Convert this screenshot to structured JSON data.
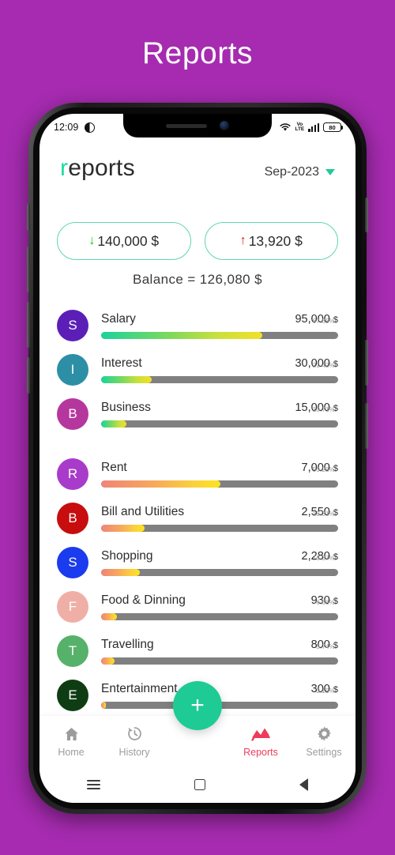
{
  "page": {
    "title": "Reports",
    "background_color": "#A62BB0"
  },
  "status_bar": {
    "time": "12:09",
    "dnd_icon": "do-not-disturb-icon",
    "wifi_icon": "wifi-icon",
    "volte_top": "Vo",
    "volte_bottom": "LTE",
    "signal_icon": "signal-bars-icon",
    "battery_level": "80"
  },
  "app_header": {
    "brand_first": "r",
    "brand_rest": "eports",
    "month": "Sep-2023",
    "dropdown_icon": "chevron-down-icon"
  },
  "summary": {
    "income": {
      "label": "140,000 $",
      "arrow": "↓",
      "direction": "down"
    },
    "expense": {
      "label": "13,920 $",
      "arrow": "↑",
      "direction": "up"
    },
    "balance_label": "Balance  =  126,080 $"
  },
  "income_categories": [
    {
      "initial": "S",
      "name": "Salary",
      "amount": "95,000",
      "currency": "$",
      "color": "#5B1FB8",
      "percent": 67.9,
      "percent_label": "67.85%"
    },
    {
      "initial": "I",
      "name": "Interest",
      "amount": "30,000",
      "currency": "$",
      "color": "#2C8FA6",
      "percent": 21.4,
      "percent_label": "21.42%"
    },
    {
      "initial": "B",
      "name": "Business",
      "amount": "15,000",
      "currency": "$",
      "color": "#B5379E",
      "percent": 10.7,
      "percent_label": "10.71%"
    }
  ],
  "expense_categories": [
    {
      "initial": "R",
      "name": "Rent",
      "amount": "7,000",
      "currency": "$",
      "color": "#A93BCB",
      "percent": 50.2,
      "percent_label": "50.28%"
    },
    {
      "initial": "B",
      "name": "Bill and Utilities",
      "amount": "2,550",
      "currency": "$",
      "color": "#C70D0D",
      "percent": 18.3,
      "percent_label": "18.31%"
    },
    {
      "initial": "S",
      "name": "Shopping",
      "amount": "2,280",
      "currency": "$",
      "color": "#1B3BEF",
      "percent": 16.3,
      "percent_label": "16.37%"
    },
    {
      "initial": "F",
      "name": "Food & Dinning",
      "amount": "930",
      "currency": "$",
      "color": "#F0AFA6",
      "percent": 6.6,
      "percent_label": "6.68%"
    },
    {
      "initial": "T",
      "name": "Travelling",
      "amount": "800",
      "currency": "$",
      "color": "#56B16A",
      "percent": 5.7,
      "percent_label": "5.74%"
    },
    {
      "initial": "E",
      "name": "Entertainment",
      "amount": "300",
      "currency": "$",
      "color": "#0F3D13",
      "percent": 2.1,
      "percent_label": "2.15%"
    }
  ],
  "fab": {
    "label": "+",
    "icon": "plus-icon",
    "color": "#1FCB95"
  },
  "bottom_nav": {
    "active": "Reports",
    "items": [
      {
        "label": "Home",
        "icon": "home-icon"
      },
      {
        "label": "History",
        "icon": "history-clock-icon"
      },
      {
        "label": "Reports",
        "icon": "chart-zigzag-icon"
      },
      {
        "label": "Settings",
        "icon": "gear-icon"
      }
    ]
  },
  "system_bar": {
    "recents_icon": "hamburger-recents-icon",
    "home_icon": "square-home-icon",
    "back_icon": "triangle-back-icon"
  }
}
